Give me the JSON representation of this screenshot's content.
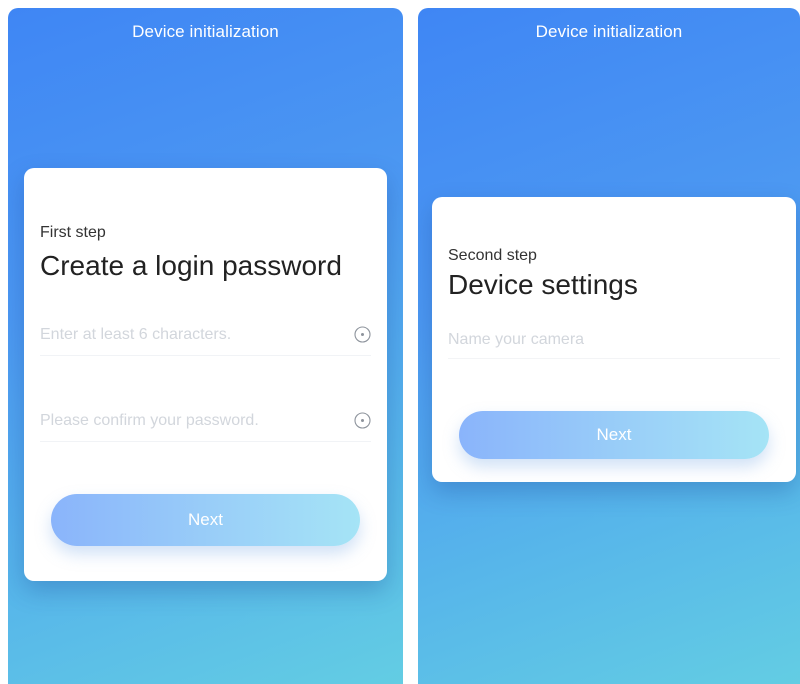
{
  "screens": [
    {
      "header_title": "Device initialization",
      "step_label": "First step",
      "step_title": "Create a login password",
      "fields": [
        {
          "placeholder": "Enter at least 6 characters.",
          "icon": "eye-icon"
        },
        {
          "placeholder": "Please confirm your password.",
          "icon": "eye-icon"
        }
      ],
      "next_label": "Next"
    },
    {
      "header_title": "Device initialization",
      "step_label": "Second step",
      "step_title": "Device settings",
      "fields": [
        {
          "placeholder": "Name your camera"
        }
      ],
      "next_label": "Next"
    }
  ],
  "colors": {
    "background_gradient_start": "#3f86f4",
    "background_gradient_end": "#63cde3",
    "button_gradient_start": "#8ab4fb",
    "button_gradient_end": "#a5e4f6",
    "placeholder_text": "#d2d6dc"
  }
}
